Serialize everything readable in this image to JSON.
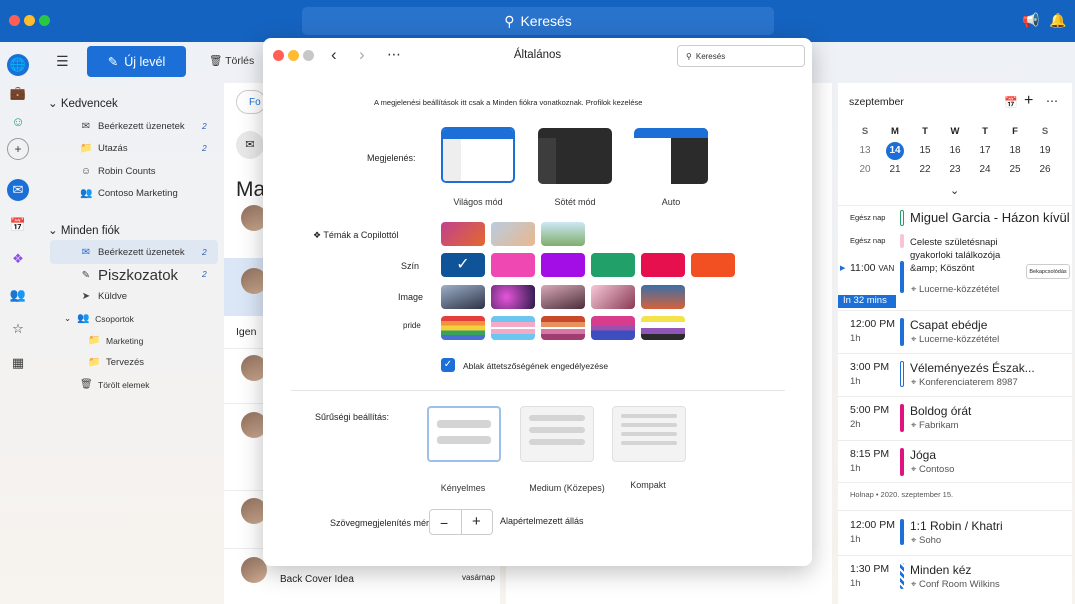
{
  "topbar": {
    "search_label": "Keresés"
  },
  "toolbar": {
    "new_mail": "Új levél",
    "delete": "Törlés"
  },
  "folders": {
    "favorites_label": "Kedvencek",
    "favorites": [
      {
        "label": "Beérkezett üzenetek",
        "count": "2"
      },
      {
        "label": "Utazás",
        "count": "2"
      },
      {
        "label": "Robin Counts",
        "count": ""
      },
      {
        "label": "Contoso Marketing",
        "count": ""
      }
    ],
    "all_accounts_label": "Minden fiók",
    "all": [
      {
        "label": "Beérkezett üzenetek",
        "count": "2"
      },
      {
        "label": "Piszkozatok",
        "count": "2"
      },
      {
        "label": "Küldve",
        "count": ""
      },
      {
        "label": "Csoportok",
        "count": ""
      },
      {
        "label": "Marketing",
        "count": ""
      },
      {
        "label": "Tervezés",
        "count": ""
      },
      {
        "label": "Törölt elemek",
        "count": ""
      }
    ]
  },
  "msglist": {
    "focused_tab": "Fo",
    "header_fragment": "Ma",
    "row_fragment": "Igen",
    "last_subject": "Back Cover Idea",
    "last_date": "vasárnap"
  },
  "calendar": {
    "month": "szeptember",
    "weekdays": [
      "S",
      "M",
      "T",
      "W",
      "T",
      "F",
      "S"
    ],
    "weeks": [
      [
        "13",
        "14",
        "15",
        "16",
        "17",
        "18",
        "19"
      ],
      [
        "20",
        "21",
        "22",
        "23",
        "24",
        "25",
        "26"
      ]
    ],
    "today": "14",
    "allday_label": "Egész nap",
    "allday_events": [
      "Miguel Garcia - Házon kívül",
      "Celeste születésnapi gyakorloki találkozója &amp; Köszönt"
    ],
    "now_time": "11:00",
    "now_label": "VAN",
    "in_label": "In 32 mins",
    "join_label": "Bekapcsolódás",
    "events": [
      {
        "time": "",
        "dur": "",
        "title": "",
        "loc": "Lucerne-közzététel",
        "color": "#1b6fd6"
      },
      {
        "time": "12:00 PM",
        "dur": "1h",
        "title": "Csapat ebédje",
        "loc": "Lucerne-közzététel",
        "color": "#1b6fd6"
      },
      {
        "time": "3:00 PM",
        "dur": "1h",
        "title": "Véleményezés Észak...",
        "loc": "Konferenciaterem 8987",
        "color": "#1b6fd6"
      },
      {
        "time": "5:00 PM",
        "dur": "2h",
        "title": "Boldog órát",
        "loc": "Fabrikam",
        "color": "#e0127e"
      },
      {
        "time": "8:15 PM",
        "dur": "1h",
        "title": "Jóga",
        "loc": "Contoso",
        "color": "#e0127e"
      }
    ],
    "tomorrow_label": "Holnap • 2020. szeptember 15.",
    "tomorrow_events": [
      {
        "time": "12:00 PM",
        "dur": "1h",
        "title": "1:1 Robin / Khatri",
        "loc": "Soho",
        "color": "#1b6fd6"
      },
      {
        "time": "1:30 PM",
        "dur": "1h",
        "title": "Minden kéz",
        "loc": "Conf Room Wilkins",
        "color": "#1b6fd6"
      }
    ]
  },
  "dialog": {
    "title": "Általános",
    "search_placeholder": "Keresés",
    "notice": "A megjelenési beállítások itt csak a Minden fiókra vonatkoznak. Profilok kezelése",
    "appearance_label": "Megjelenés:",
    "appearance_options": [
      "Világos mód",
      "Sötét mód",
      "Auto"
    ],
    "copilot_themes_label": "Témák a Copilottól",
    "color_label": "Szín",
    "image_label": "Image",
    "pride_label": "pride",
    "colors": [
      "#0f5499",
      "#f048b3",
      "#a40ee6",
      "#21a06a",
      "#e5104d",
      "#f25022"
    ],
    "transparency_label": "Ablak áttetszőségének engedélyezése",
    "density_label": "Sűrűségi beállítás:",
    "density_options": [
      "Kényelmes",
      "Medium (Közepes)",
      "Kompakt"
    ],
    "text_size_label": "Szövegmegjelenítés mérete",
    "text_size_default": "Alapértelmezett állás"
  }
}
